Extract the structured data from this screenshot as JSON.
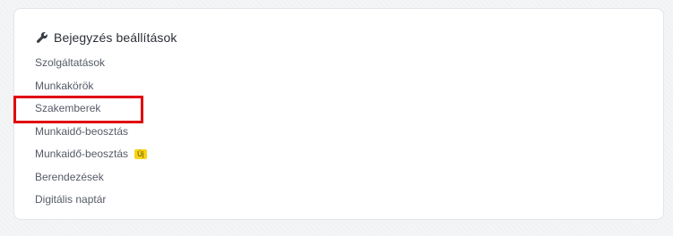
{
  "settings_card": {
    "title": "Bejegyzés beállítások",
    "header_icon": "wrench-icon",
    "items": [
      {
        "label": "Szolgáltatások"
      },
      {
        "label": "Munkakörök"
      },
      {
        "label": "Szakemberek",
        "highlighted": true
      },
      {
        "label": "Munkaidő-beosztás"
      },
      {
        "label": "Munkaidő-beosztás",
        "badge": "Új"
      },
      {
        "label": "Berendezések"
      },
      {
        "label": "Digitális naptár"
      }
    ]
  },
  "colors": {
    "highlight_border": "#e0070c",
    "badge_background": "#f7d417",
    "text": "#555b66",
    "title": "#2b2f36"
  }
}
